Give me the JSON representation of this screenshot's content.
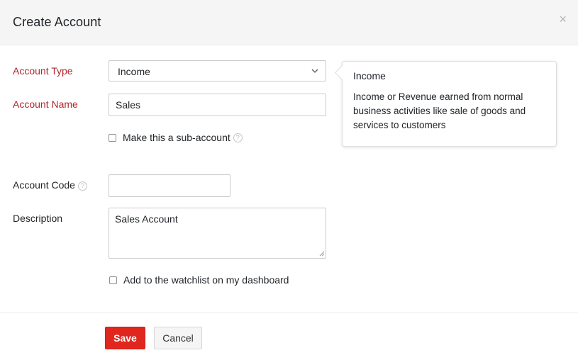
{
  "dialog": {
    "title": "Create Account",
    "close_glyph": "×"
  },
  "form": {
    "account_type": {
      "label": "Account Type",
      "value": "Income"
    },
    "account_name": {
      "label": "Account Name",
      "value": "Sales"
    },
    "sub_account": {
      "label": "Make this a sub-account",
      "checked": false
    },
    "account_code": {
      "label": "Account Code",
      "value": ""
    },
    "description": {
      "label": "Description",
      "value": "Sales Account"
    },
    "watchlist": {
      "label": "Add to the watchlist on my dashboard",
      "checked": false
    }
  },
  "tooltip": {
    "title": "Income",
    "body": "Income or Revenue earned from normal business activities like sale of goods and services to customers"
  },
  "footer": {
    "save_label": "Save",
    "cancel_label": "Cancel"
  },
  "colors": {
    "required_label": "#b0262d",
    "primary_button": "#e0261d",
    "header_bg": "#f5f5f5"
  }
}
